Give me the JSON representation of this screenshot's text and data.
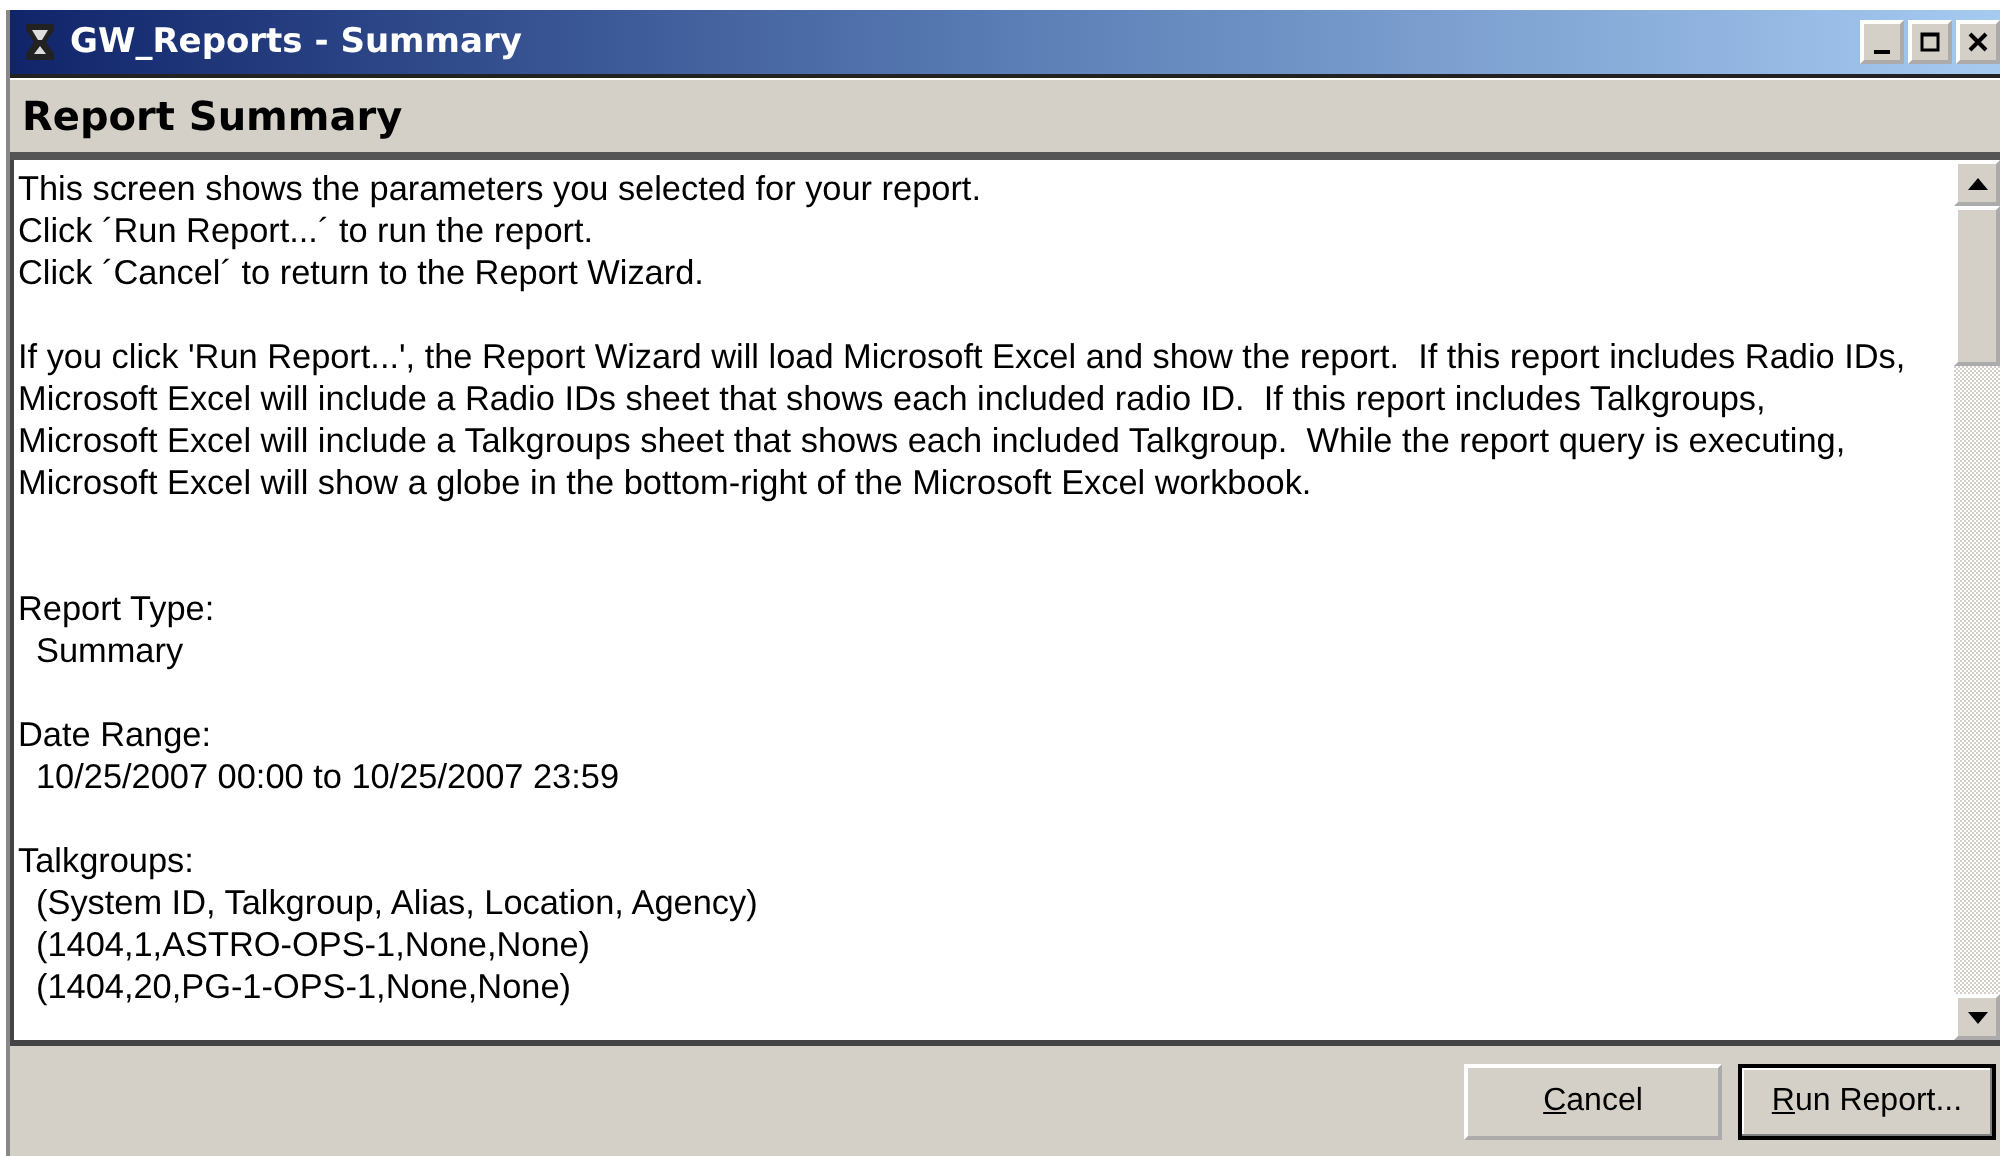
{
  "window": {
    "title": "GW_Reports - Summary"
  },
  "header": {
    "title": "Report Summary"
  },
  "blocks": [
    {
      "kind": "intro",
      "lines": [
        "This screen shows the parameters you selected for your report.",
        "Click ´Run Report...´ to run the report.",
        "Click ´Cancel´ to return to the Report Wizard."
      ]
    },
    {
      "kind": "notice",
      "lines": [
        "If you click 'Run Report...', the Report Wizard will load Microsoft Excel and show the report.  If this report includes Radio IDs,",
        "Microsoft Excel will include a Radio IDs sheet that shows each included radio ID.  If this report includes Talkgroups,",
        "Microsoft Excel will include a Talkgroups sheet that shows each included Talkgroup.  While the report query is executing,",
        "Microsoft Excel will show a globe in the bottom-right of the Microsoft Excel workbook."
      ]
    },
    {
      "kind": "param",
      "label": "Report Type:",
      "lines": [
        "Summary"
      ]
    },
    {
      "kind": "param",
      "label": "Date Range:",
      "lines": [
        "10/25/2007 00:00 to 10/25/2007 23:59"
      ]
    },
    {
      "kind": "param",
      "label": "Talkgroups:",
      "lines": [
        "(System ID, Talkgroup, Alias, Location, Agency)",
        "(1404,1,ASTRO-OPS-1,None,None)",
        "(1404,20,PG-1-OPS-1,None,None)"
      ]
    }
  ],
  "buttons": [
    {
      "label": "Cancel",
      "default": false
    },
    {
      "label": "Run Report...",
      "default": true
    }
  ]
}
